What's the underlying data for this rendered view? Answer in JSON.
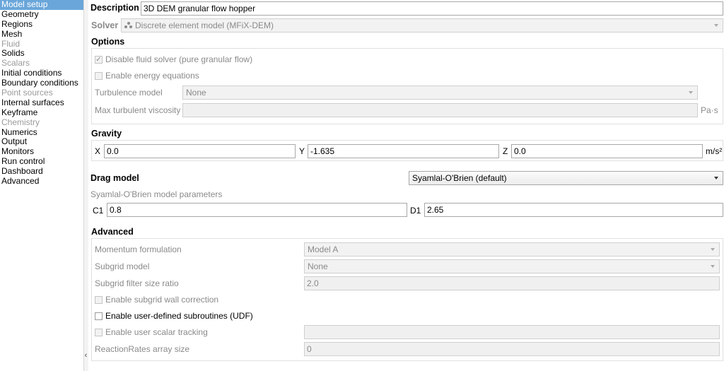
{
  "sidebar": {
    "items": [
      {
        "label": "Model setup",
        "state": "selected"
      },
      {
        "label": "Geometry",
        "state": "normal"
      },
      {
        "label": "Regions",
        "state": "normal"
      },
      {
        "label": "Mesh",
        "state": "normal"
      },
      {
        "label": "Fluid",
        "state": "disabled"
      },
      {
        "label": "Solids",
        "state": "normal"
      },
      {
        "label": "Scalars",
        "state": "disabled"
      },
      {
        "label": "Initial conditions",
        "state": "normal"
      },
      {
        "label": "Boundary conditions",
        "state": "normal"
      },
      {
        "label": "Point sources",
        "state": "disabled"
      },
      {
        "label": "Internal surfaces",
        "state": "normal"
      },
      {
        "label": "Keyframe",
        "state": "normal"
      },
      {
        "label": "Chemistry",
        "state": "disabled"
      },
      {
        "label": "Numerics",
        "state": "normal"
      },
      {
        "label": "Output",
        "state": "normal"
      },
      {
        "label": "Monitors",
        "state": "normal"
      },
      {
        "label": "Run control",
        "state": "normal"
      },
      {
        "label": "Dashboard",
        "state": "normal"
      },
      {
        "label": "Advanced",
        "state": "normal"
      }
    ],
    "collapse_glyph": "‹"
  },
  "description": {
    "label": "Description",
    "value": "3D DEM granular flow hopper"
  },
  "solver": {
    "label": "Solver",
    "value": "Discrete element model (MFiX-DEM)",
    "icon": "particles-icon"
  },
  "options": {
    "title": "Options",
    "disable_fluid": {
      "label": "Disable fluid solver (pure granular flow)",
      "checked": true
    },
    "energy": {
      "label": "Enable energy equations",
      "checked": false
    },
    "turbulence": {
      "label": "Turbulence model",
      "value": "None"
    },
    "max_visc": {
      "label": "Max turbulent viscosity",
      "value": "",
      "unit": "Pa·s"
    }
  },
  "gravity": {
    "title": "Gravity",
    "x_label": "X",
    "x_value": "0.0",
    "y_label": "Y",
    "y_value": "-1.635",
    "z_label": "Z",
    "z_value": "0.0",
    "unit": "m/s²"
  },
  "drag": {
    "title": "Drag model",
    "value": "Syamlal-O'Brien (default)",
    "params_title": "Syamlal-O'Brien model parameters",
    "c1_label": "C1",
    "c1_value": "0.8",
    "d1_label": "D1",
    "d1_value": "2.65"
  },
  "advanced": {
    "title": "Advanced",
    "momentum": {
      "label": "Momentum formulation",
      "value": "Model A"
    },
    "subgrid": {
      "label": "Subgrid model",
      "value": "None"
    },
    "filter_ratio": {
      "label": "Subgrid filter size ratio",
      "value": "2.0"
    },
    "wall_correction": {
      "label": "Enable subgrid wall correction",
      "checked": false
    },
    "udf": {
      "label": "Enable user-defined subroutines (UDF)",
      "checked": false
    },
    "scalar_tracking": {
      "label": "Enable user scalar tracking",
      "checked": false,
      "value": ""
    },
    "reaction_rates": {
      "label": "ReactionRates array size",
      "value": "0"
    }
  },
  "colors": {
    "selection": "#6aa6da",
    "disabled_text": "#8a8a8a"
  }
}
